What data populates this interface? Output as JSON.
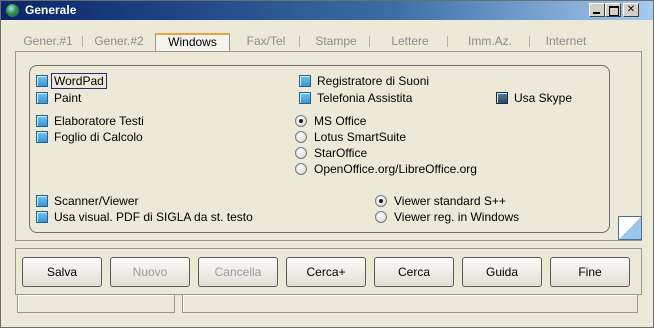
{
  "window": {
    "title": "Generale"
  },
  "tabs": [
    {
      "label": "Gener.#1",
      "active": false
    },
    {
      "label": "Gener.#2",
      "active": false
    },
    {
      "label": "Windows",
      "active": true
    },
    {
      "label": "Fax/Tel",
      "active": false
    },
    {
      "label": "Stampe",
      "active": false
    },
    {
      "label": "Lettere",
      "active": false
    },
    {
      "label": "Imm.Az.",
      "active": false
    },
    {
      "label": "Internet",
      "active": false
    }
  ],
  "options": {
    "wordpad": "WordPad",
    "paint": "Paint",
    "registratore": "Registratore di Suoni",
    "telefonia": "Telefonia Assistita",
    "usa_skype": "Usa Skype",
    "elaboratore": "Elaboratore Testi",
    "foglio": "Foglio di Calcolo",
    "scanner": "Scanner/Viewer",
    "usa_pdf": "Usa visual. PDF di SIGLA da st. testo"
  },
  "office_suite": {
    "selected": "MS Office",
    "choices": [
      "MS Office",
      "Lotus SmartSuite",
      "StarOffice",
      "OpenOffice.org/LibreOffice.org"
    ]
  },
  "viewer": {
    "selected": "Viewer standard S++",
    "choices": [
      "Viewer standard S++",
      "Viewer reg. in Windows"
    ]
  },
  "buttons": {
    "salva": "Salva",
    "nuovo": "Nuovo",
    "cancella": "Cancella",
    "cerca_plus": "Cerca+",
    "cerca": "Cerca",
    "guida": "Guida",
    "fine": "Fine"
  },
  "colors": {
    "titlebar_start": "#0a246a",
    "titlebar_end": "#a6caf0",
    "checkbox_fill": "#3a95cf",
    "active_tab_accent": "#e5a53c"
  }
}
